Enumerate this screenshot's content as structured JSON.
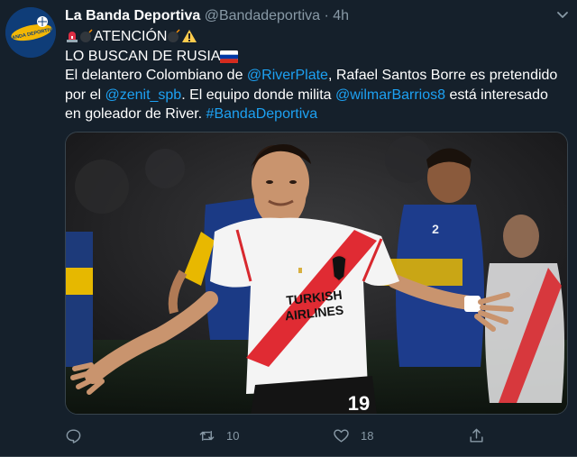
{
  "account": {
    "display_name": "La Banda Deportiva",
    "handle": "@Bandadeportiva",
    "separator": "·",
    "timestamp": "4h",
    "avatar_text": "BANDA DEPORTIVA"
  },
  "tweet": {
    "line1_text": "ATENCIÓN",
    "line2_text": "LO BUSCAN DE RUSIA",
    "line3_pre": "El delantero Colombiano de ",
    "line3_mention": "@RiverPlate",
    "line3_post": ", Rafael Santos Borre es pretendido",
    "line4_pre": "por el ",
    "line4_mention": "@zenit_spb",
    "line4_mid": ". El equipo donde milita ",
    "line4_mention2": "@wilmarBarrios8",
    "line4_post": " está interesado",
    "line5_pre": "en goleador de River. ",
    "line5_hashtag": "#BandaDeportiva"
  },
  "media": {
    "sponsor_line1": "TURKISH",
    "sponsor_line2": "AIRLINES",
    "shirt_number": "19"
  },
  "actions": {
    "reply_count": "",
    "retweet_count": "10",
    "like_count": "18"
  },
  "colors": {
    "background": "#15202b",
    "link": "#1da1f2",
    "muted": "#8899a6",
    "border": "#38444d"
  },
  "icons": [
    "reply-icon",
    "retweet-icon",
    "like-icon",
    "share-icon",
    "caret-down-icon",
    "siren-icon",
    "bomb-icon",
    "warning-icon",
    "russia-flag-icon"
  ]
}
